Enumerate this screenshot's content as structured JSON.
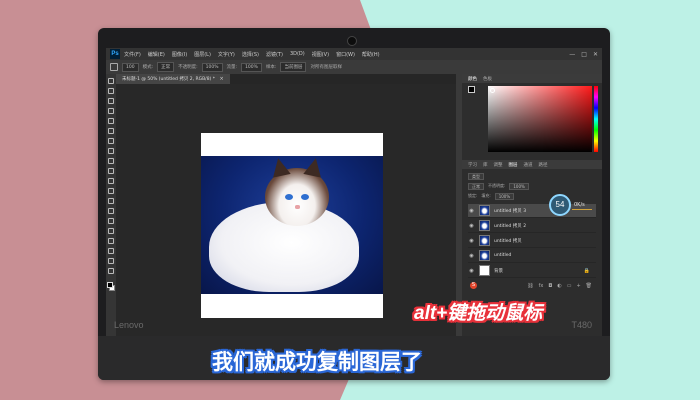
{
  "app": {
    "menus": [
      "文件(F)",
      "编辑(E)",
      "图像(I)",
      "图层(L)",
      "文字(Y)",
      "选择(S)",
      "滤镜(T)",
      "3D(D)",
      "视图(V)",
      "窗口(W)",
      "帮助(H)"
    ],
    "window_buttons": [
      "—",
      "□",
      "✕"
    ]
  },
  "options_bar": {
    "size": "100",
    "mode_label": "模式:",
    "mode_value": "正常",
    "opacity_label": "不透明度:",
    "opacity_value": "100%",
    "flow_label": "流量:",
    "flow_value": "100%",
    "sample_label": "样本:",
    "sample_value": "当前图层",
    "checkbox_label": "对所有图层取样"
  },
  "document_tab": {
    "title": "未标题-1 @ 50% (untitled 拷贝 2, RGB/8) *",
    "close": "×"
  },
  "panels": {
    "color_tabs": [
      "颜色",
      "色板"
    ],
    "layer_tabs": [
      "学习",
      "库",
      "调整",
      "图层",
      "通道",
      "路径"
    ],
    "kind_label": "类型",
    "blend_mode": "正常",
    "opacity_label": "不透明度:",
    "opacity_value": "100%",
    "lock_label": "锁定:",
    "fill_label": "填充:",
    "fill_value": "100%",
    "layers": [
      {
        "name": "untitled 拷贝 3",
        "active": true,
        "thumb": "cat"
      },
      {
        "name": "untitled 拷贝 2",
        "active": false,
        "thumb": "cat"
      },
      {
        "name": "untitled 拷贝",
        "active": false,
        "thumb": "cat"
      },
      {
        "name": "untitled",
        "active": false,
        "thumb": "cat"
      },
      {
        "name": "背景",
        "active": false,
        "thumb": "white"
      }
    ]
  },
  "overlay": {
    "percent": "54",
    "percent_sub": "0K/s"
  },
  "laptop": {
    "brand_left": "Lenovo",
    "brand_right": "T480"
  },
  "captions": {
    "hotkey": "alt+键拖动鼠标",
    "main": "我们就成功复制图层了"
  },
  "colors": {
    "hotkey_outline": "#e8313a",
    "main_outline": "#2a67d6",
    "photo_bg": "#0d2570"
  }
}
